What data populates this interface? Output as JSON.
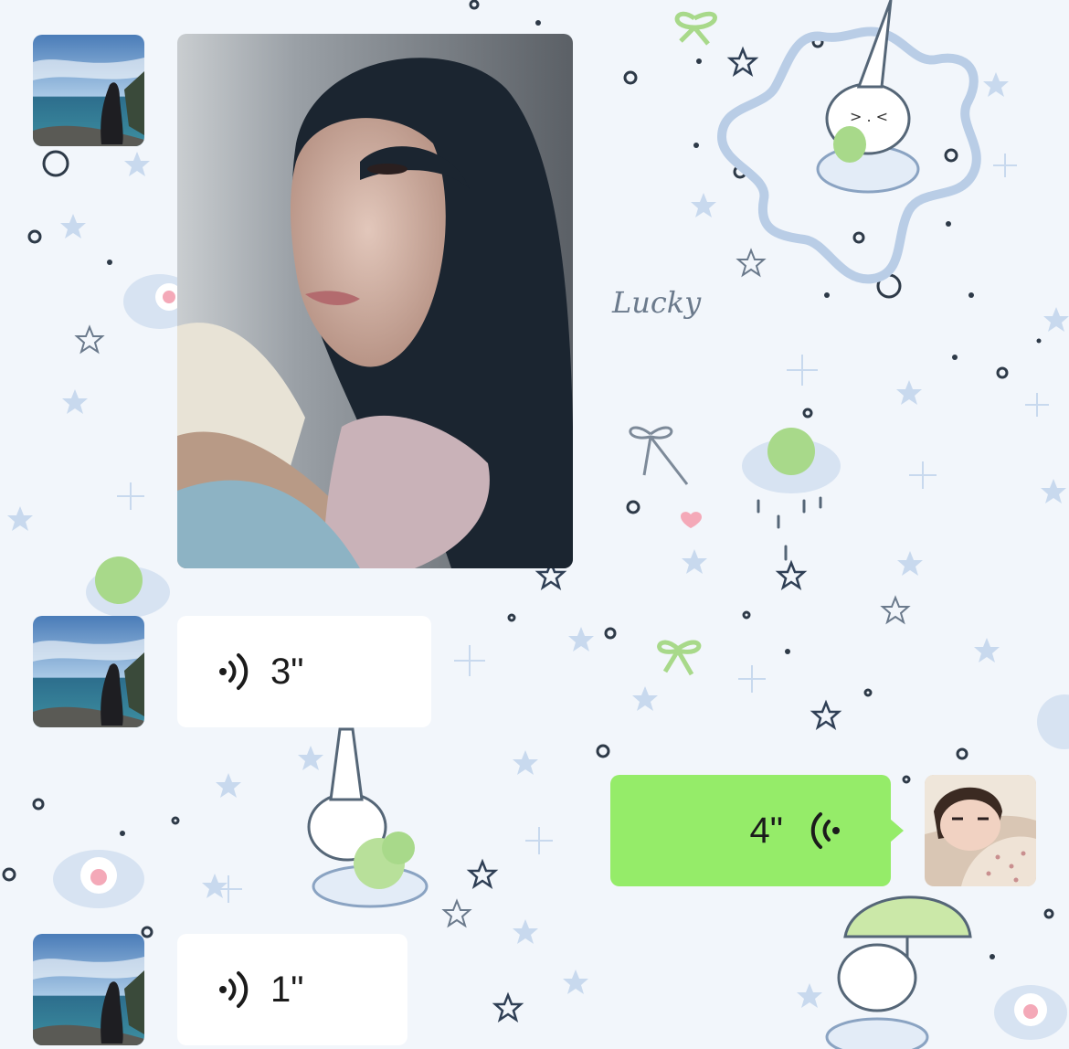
{
  "wallpaper": {
    "text": "Lucky",
    "colors": {
      "background": "#f2f6fb",
      "accent_blue": "#b9cde6",
      "accent_green": "#a8d98a"
    }
  },
  "messages": [
    {
      "direction": "incoming",
      "kind": "photo"
    },
    {
      "direction": "incoming",
      "kind": "voice",
      "duration": "3\""
    },
    {
      "direction": "outgoing",
      "kind": "voice",
      "duration": "4\""
    },
    {
      "direction": "incoming",
      "kind": "voice",
      "duration": "1\""
    }
  ],
  "colors": {
    "outgoing_bubble": "#95ec69",
    "incoming_bubble": "#ffffff"
  }
}
